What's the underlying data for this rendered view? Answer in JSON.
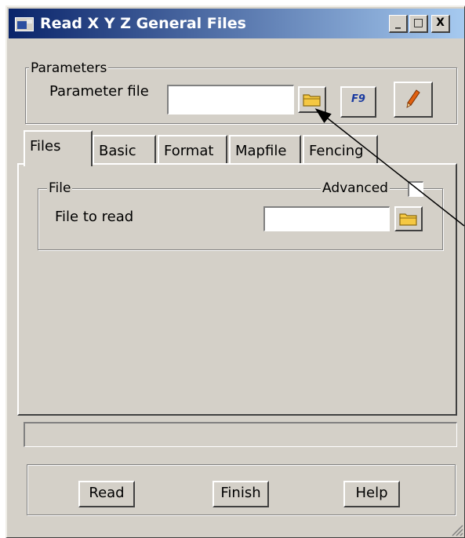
{
  "window": {
    "title": "Read X Y Z General Files",
    "minimize": "_",
    "maximize": "□",
    "close": "X"
  },
  "parameters": {
    "group_label": "Parameters",
    "file_label": "Parameter file",
    "file_value": "",
    "f9_label": "F9"
  },
  "tabs": [
    {
      "label": "Files",
      "active": true
    },
    {
      "label": "Basic",
      "active": false
    },
    {
      "label": "Format",
      "active": false
    },
    {
      "label": "Mapfile",
      "active": false
    },
    {
      "label": "Fencing",
      "active": false
    }
  ],
  "file_group": {
    "group_label": "File",
    "advanced_label": "Advanced",
    "advanced_checked": false,
    "file_to_read_label": "File to read",
    "file_to_read_value": ""
  },
  "status_text": "",
  "buttons": {
    "read": "Read",
    "finish": "Finish",
    "help": "Help"
  },
  "colors": {
    "face": "#d4d0c8",
    "title_start": "#0a246a",
    "title_end": "#a6caf0",
    "folder": "#f5c842"
  }
}
